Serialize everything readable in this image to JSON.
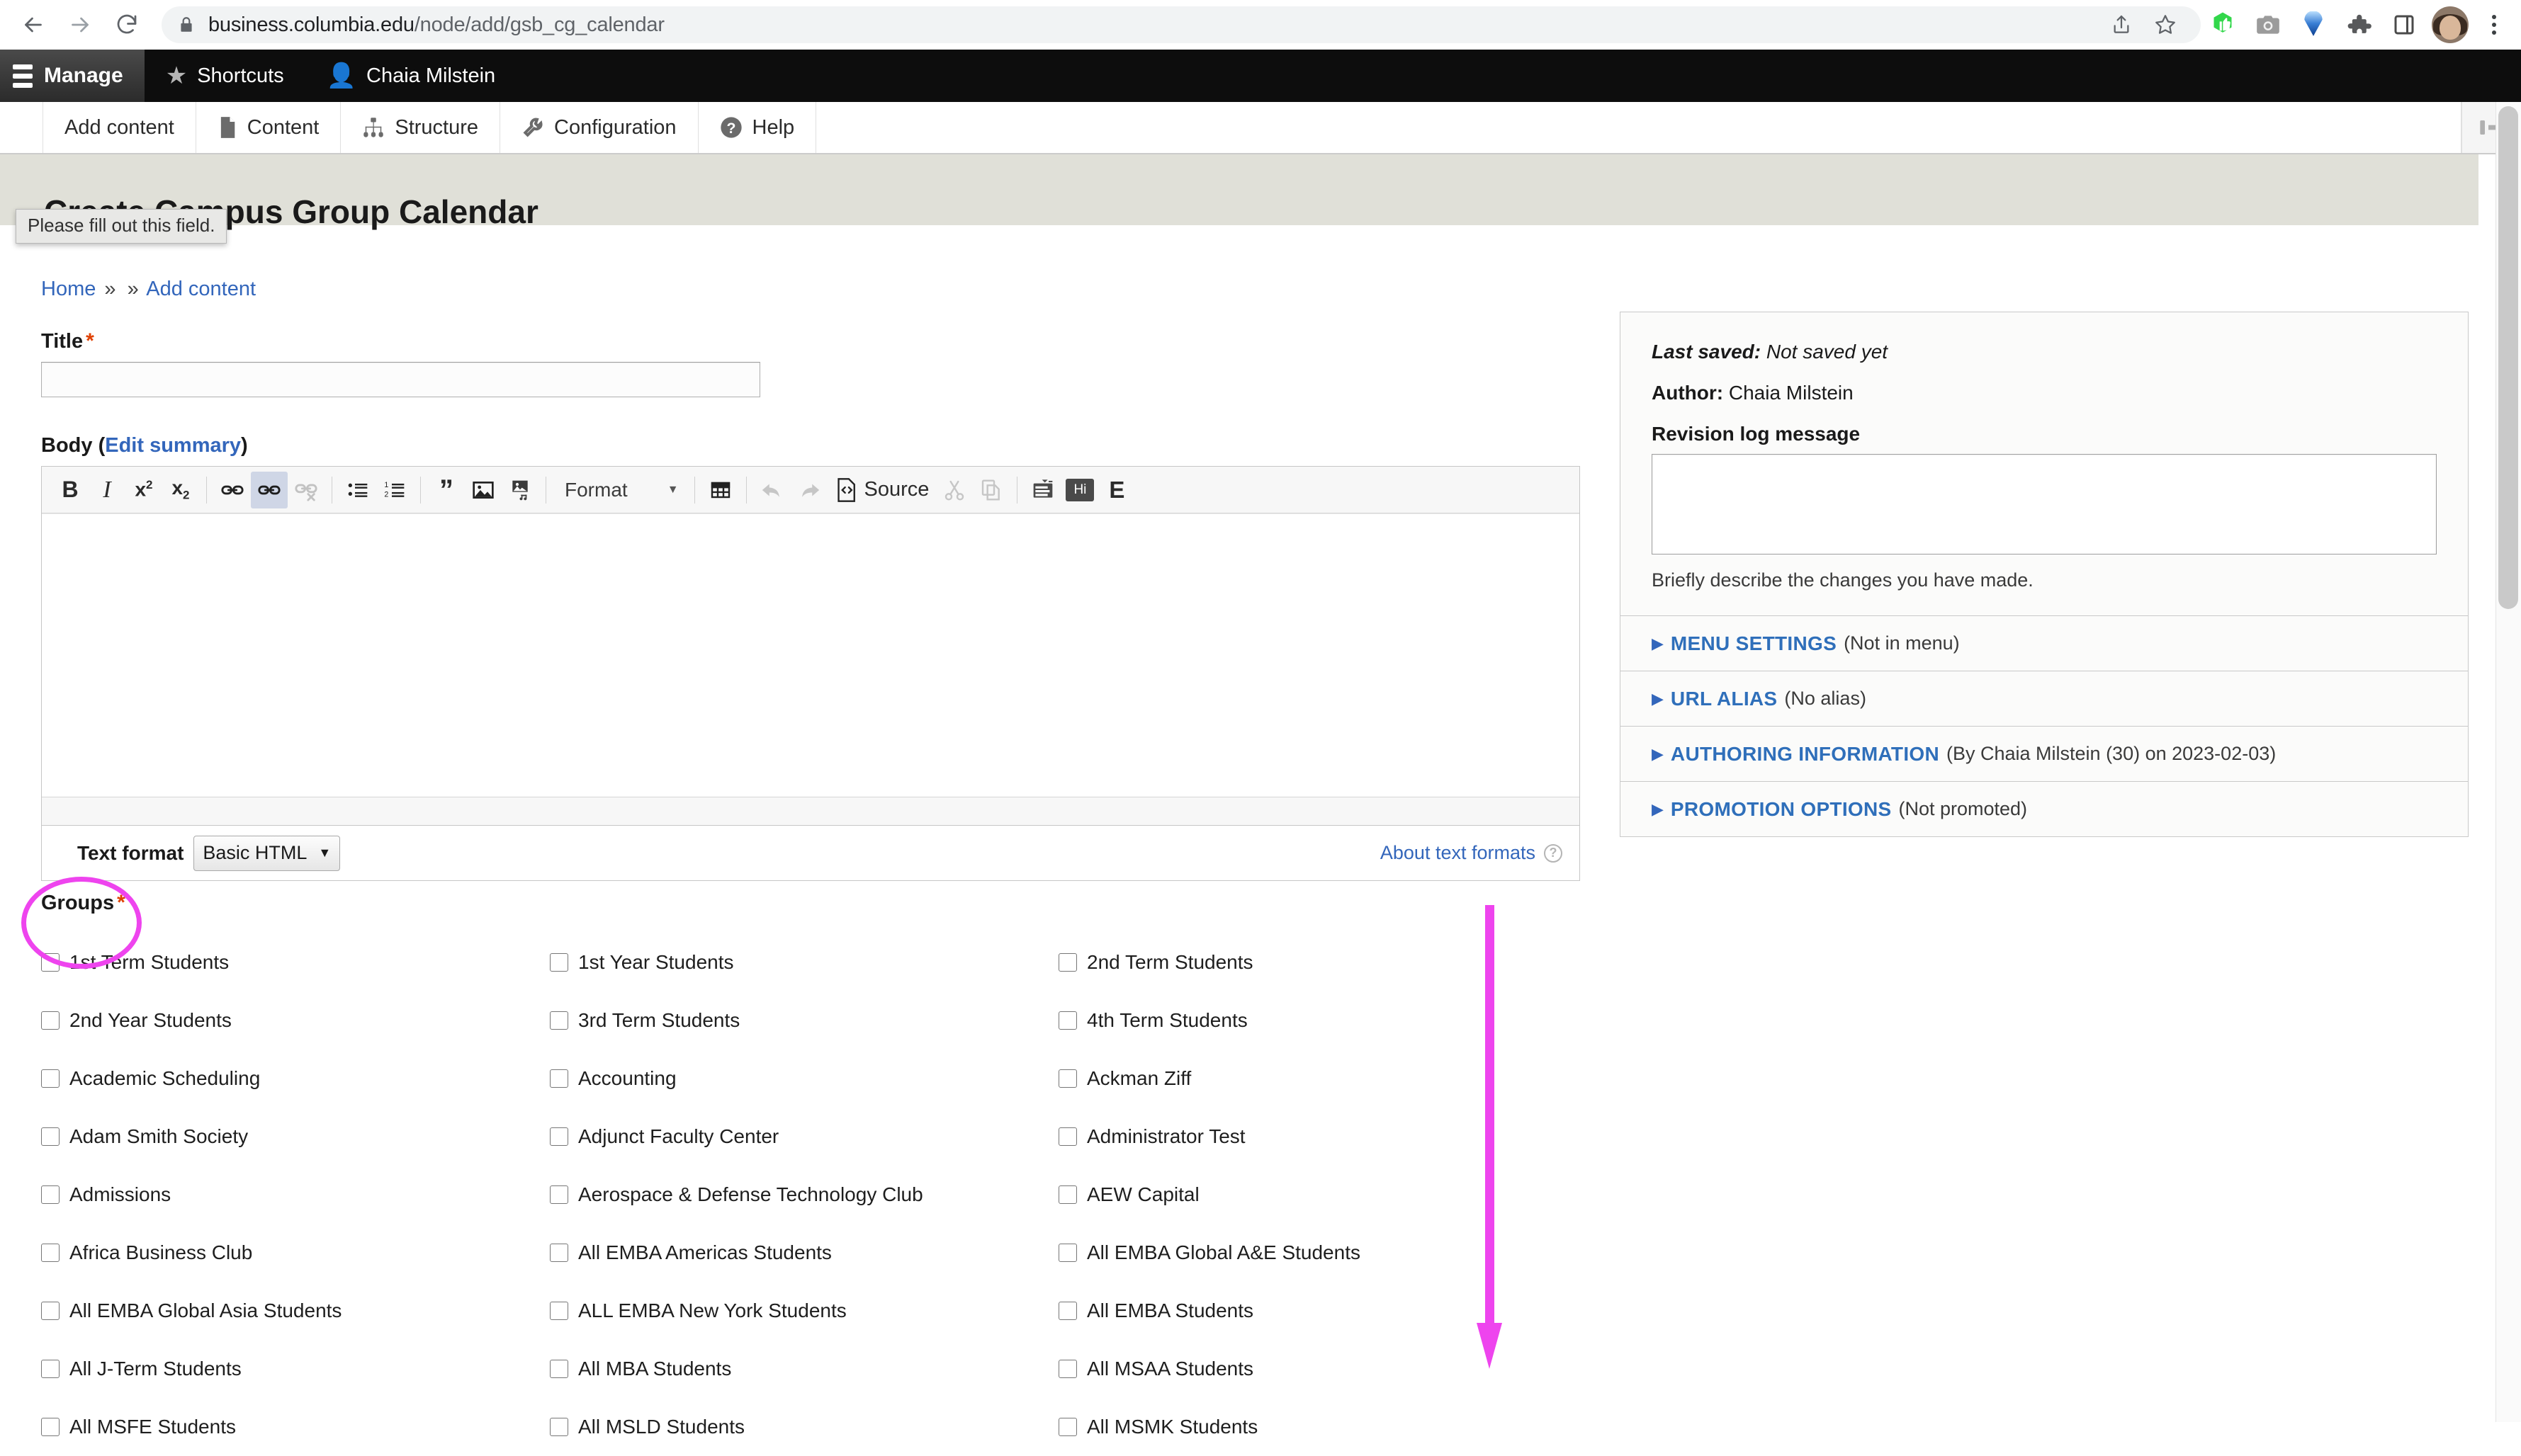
{
  "browser": {
    "url_host": "business.columbia.edu",
    "url_path": "/node/add/gsb_cg_calendar",
    "icons": {
      "back": "back-arrow-icon",
      "forward": "forward-arrow-icon",
      "reload": "reload-icon",
      "lock": "lock-icon",
      "share": "share-icon",
      "bookmark": "star-outline-icon",
      "ext_thumbsup": "green-thumbs-up-icon",
      "ext_camera": "camera-icon",
      "ext_grammarly": "blue-pin-icon",
      "ext_puzzle": "extensions-puzzle-icon",
      "ext_sidepanel": "side-panel-icon",
      "avatar": "profile-avatar-icon",
      "menu": "three-dot-menu-icon"
    }
  },
  "admin_toolbar": {
    "manage": "Manage",
    "shortcuts": "Shortcuts",
    "user": "Chaia Milstein"
  },
  "admin_menu": [
    {
      "label": "Add content",
      "icon": "none"
    },
    {
      "label": "Content",
      "icon": "document-icon"
    },
    {
      "label": "Structure",
      "icon": "structure-tree-icon"
    },
    {
      "label": "Configuration",
      "icon": "wrench-icon"
    },
    {
      "label": "Help",
      "icon": "question-mark-icon"
    }
  ],
  "toolbar_orientation_toggle": "vertical-orientation-toggle-icon",
  "page": {
    "title": "Create Campus Group Calendar",
    "tooltip": "Please fill out this field."
  },
  "breadcrumb": {
    "home": "Home",
    "sep1": "»",
    "sep2": "»",
    "add_content": "Add content"
  },
  "form": {
    "title_label": "Title",
    "title_required": "*",
    "title_value": "",
    "body_label": "Body",
    "body_edit_summary": "Edit summary",
    "body_value": "",
    "groups_label": "Groups",
    "groups_required": "*"
  },
  "editor": {
    "buttons": [
      {
        "name": "bold",
        "glyph": "B"
      },
      {
        "name": "italic",
        "glyph": "I"
      },
      {
        "name": "superscript",
        "glyph": "x²"
      },
      {
        "name": "subscript",
        "glyph": "x₂"
      },
      {
        "name": "link",
        "glyph": "🔗"
      },
      {
        "name": "anchor",
        "glyph": "🔗"
      },
      {
        "name": "unlink",
        "glyph": "🔗"
      },
      {
        "name": "bulleted-list",
        "glyph": "☰"
      },
      {
        "name": "numbered-list",
        "glyph": "☰"
      },
      {
        "name": "blockquote",
        "glyph": "”"
      },
      {
        "name": "image",
        "glyph": "🖼"
      },
      {
        "name": "media",
        "glyph": "🎵"
      },
      {
        "name": "table",
        "glyph": "⊞"
      },
      {
        "name": "undo",
        "glyph": "↶"
      },
      {
        "name": "redo",
        "glyph": "↷"
      },
      {
        "name": "source",
        "glyph": "<>"
      },
      {
        "name": "cut",
        "glyph": "✂"
      },
      {
        "name": "copy",
        "glyph": "⎘"
      },
      {
        "name": "templates",
        "glyph": "▤"
      },
      {
        "name": "highlight",
        "glyph": "Hi"
      },
      {
        "name": "entities",
        "glyph": "E"
      }
    ],
    "format_label": "Format",
    "source_label": "Source",
    "highlight_label": "Hi",
    "entities_label": "E",
    "text_format_label": "Text format",
    "text_format_value": "Basic HTML",
    "about_text_formats": "About text formats",
    "help_glyph": "?"
  },
  "sidebar": {
    "last_saved_label": "Last saved:",
    "last_saved_value": "Not saved yet",
    "author_label": "Author:",
    "author_value": "Chaia Milstein",
    "revision_label": "Revision log message",
    "revision_value": "",
    "revision_hint": "Briefly describe the changes you have made.",
    "sections": [
      {
        "title": "MENU SETTINGS",
        "summary": "(Not in menu)"
      },
      {
        "title": "URL ALIAS",
        "summary": "(No alias)"
      },
      {
        "title": "AUTHORING INFORMATION",
        "summary": "(By Chaia Milstein (30) on 2023-02-03)"
      },
      {
        "title": "PROMOTION OPTIONS",
        "summary": "(Not promoted)"
      }
    ]
  },
  "groups": [
    "1st Term Students",
    "1st Year Students",
    "2nd Term Students",
    "2nd Year Students",
    "3rd Term Students",
    "4th Term Students",
    "Academic Scheduling",
    "Accounting",
    "Ackman Ziff",
    "Adam Smith Society",
    "Adjunct Faculty Center",
    "Administrator Test",
    "Admissions",
    "Aerospace & Defense Technology Club",
    "AEW Capital",
    "Africa Business Club",
    "All EMBA Americas Students",
    "All EMBA Global A&E Students",
    "All EMBA Global Asia Students",
    "ALL EMBA New York Students",
    "All EMBA Students",
    "All J-Term Students",
    "All MBA Students",
    "All MSAA Students",
    "All MSFE Students",
    "All MSLD Students",
    "All MSMK Students"
  ],
  "annotations": {
    "circle_target": "groups-label-highlight",
    "arrow_target": "groups-list-scroll-indicator",
    "color": "#ee44ee"
  }
}
